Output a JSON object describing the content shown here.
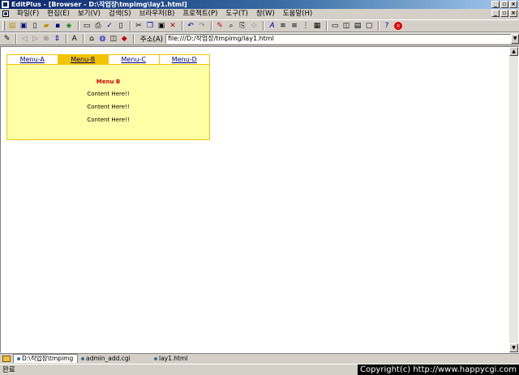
{
  "window": {
    "title": "EditPlus - [Browser - D:\\작업장\\tmpimg\\lay1.html]",
    "controls": [
      "_",
      "▫",
      "×"
    ]
  },
  "menu": {
    "items": [
      "파일(F)",
      "편집(E)",
      "보기(V)",
      "검색(S)",
      "브라우저(B)",
      "프로젝트(P)",
      "도구(T)",
      "창(W)",
      "도움말(H)"
    ]
  },
  "doc_controls": [
    "_",
    "▫",
    "×"
  ],
  "address": {
    "label": "주소(A)",
    "value": "file:///D:/작업장/tmpimg/lay1.html"
  },
  "page": {
    "tabs": [
      "Menu-A",
      "Menu-B",
      "Menu-C",
      "Menu-D"
    ],
    "active_tab": 1,
    "panel_title": "Menu B",
    "panel_lines": [
      "Content Here!!",
      "Content Here!!",
      "Content Here!!"
    ],
    "colors": {
      "border": "#f2c400",
      "active_tab_bg": "#f2c400",
      "panel_bg": "#ffffa8",
      "panel_title": "#cc0000",
      "tab_link": "#000080"
    }
  },
  "doc_tabs": [
    "D:\\작업장\\tmpimg",
    "admin_add.cgi",
    "lay1.html"
  ],
  "status": {
    "text": "완료"
  },
  "overlay": {
    "copyright": "Copyright(c) http://www.happycgi.com"
  }
}
